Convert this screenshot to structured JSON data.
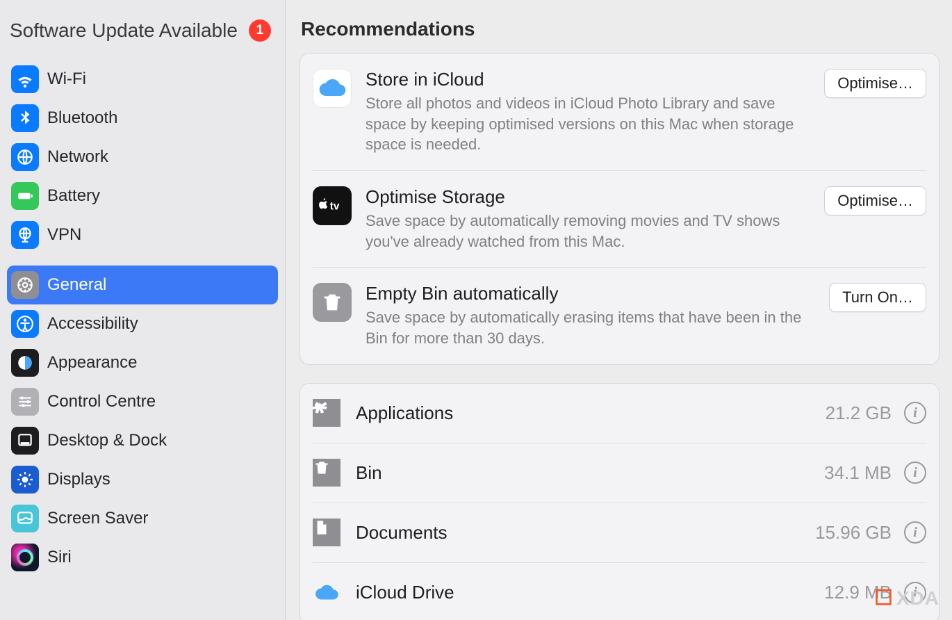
{
  "sidebar": {
    "update": {
      "title": "Software Update Available",
      "badge": "1"
    },
    "group1": [
      {
        "label": "Wi-Fi",
        "name": "wifi",
        "bg": "bg-blue",
        "icon": "wifi"
      },
      {
        "label": "Bluetooth",
        "name": "bluetooth",
        "bg": "bg-blue",
        "icon": "bluetooth"
      },
      {
        "label": "Network",
        "name": "network",
        "bg": "bg-blue",
        "icon": "globe"
      },
      {
        "label": "Battery",
        "name": "battery",
        "bg": "bg-green",
        "icon": "battery"
      },
      {
        "label": "VPN",
        "name": "vpn",
        "bg": "bg-blue",
        "icon": "globe-vpn"
      }
    ],
    "group2": [
      {
        "label": "General",
        "name": "general",
        "bg": "bg-gray",
        "icon": "gear",
        "selected": true
      },
      {
        "label": "Accessibility",
        "name": "accessibility",
        "bg": "bg-blue",
        "icon": "access"
      },
      {
        "label": "Appearance",
        "name": "appearance",
        "bg": "bg-black",
        "icon": "appearance"
      },
      {
        "label": "Control Centre",
        "name": "control-centre",
        "bg": "bg-grayL",
        "icon": "sliders"
      },
      {
        "label": "Desktop & Dock",
        "name": "desktop-dock",
        "bg": "bg-black",
        "icon": "dock"
      },
      {
        "label": "Displays",
        "name": "displays",
        "bg": "bg-dblue",
        "icon": "sun"
      },
      {
        "label": "Screen Saver",
        "name": "screen-saver",
        "bg": "bg-teal",
        "icon": "screensaver"
      },
      {
        "label": "Siri",
        "name": "siri",
        "bg": "siri",
        "icon": "siri"
      }
    ]
  },
  "main": {
    "section_title": "Recommendations",
    "recommendations": [
      {
        "name": "store-in-icloud",
        "title": "Store in iCloud",
        "desc": "Store all photos and videos in iCloud Photo Library and save space by keeping optimised versions on this Mac when storage space is needed.",
        "button": "Optimise…",
        "iconClass": "white",
        "icon": "cloud"
      },
      {
        "name": "optimise-storage",
        "title": "Optimise Storage",
        "desc": "Save space by automatically removing movies and TV shows you've already watched from this Mac.",
        "button": "Optimise…",
        "iconClass": "black",
        "icon": "appletv"
      },
      {
        "name": "empty-bin-automatically",
        "title": "Empty Bin automatically",
        "desc": "Save space by automatically erasing items that have been in the Bin for more than 30 days.",
        "button": "Turn On…",
        "iconClass": "gray",
        "icon": "trash"
      }
    ],
    "storage": [
      {
        "name": "applications",
        "label": "Applications",
        "size": "21.2 GB",
        "icon": "apps",
        "bg": "bg-gray"
      },
      {
        "name": "bin",
        "label": "Bin",
        "size": "34.1 MB",
        "icon": "trash",
        "bg": "bg-gray"
      },
      {
        "name": "documents",
        "label": "Documents",
        "size": "15.96 GB",
        "icon": "doc",
        "bg": "bg-gray"
      },
      {
        "name": "icloud-drive",
        "label": "iCloud Drive",
        "size": "12.9 MB",
        "icon": "cloud",
        "bg": ""
      }
    ]
  },
  "watermark": {
    "text": "XDA"
  }
}
